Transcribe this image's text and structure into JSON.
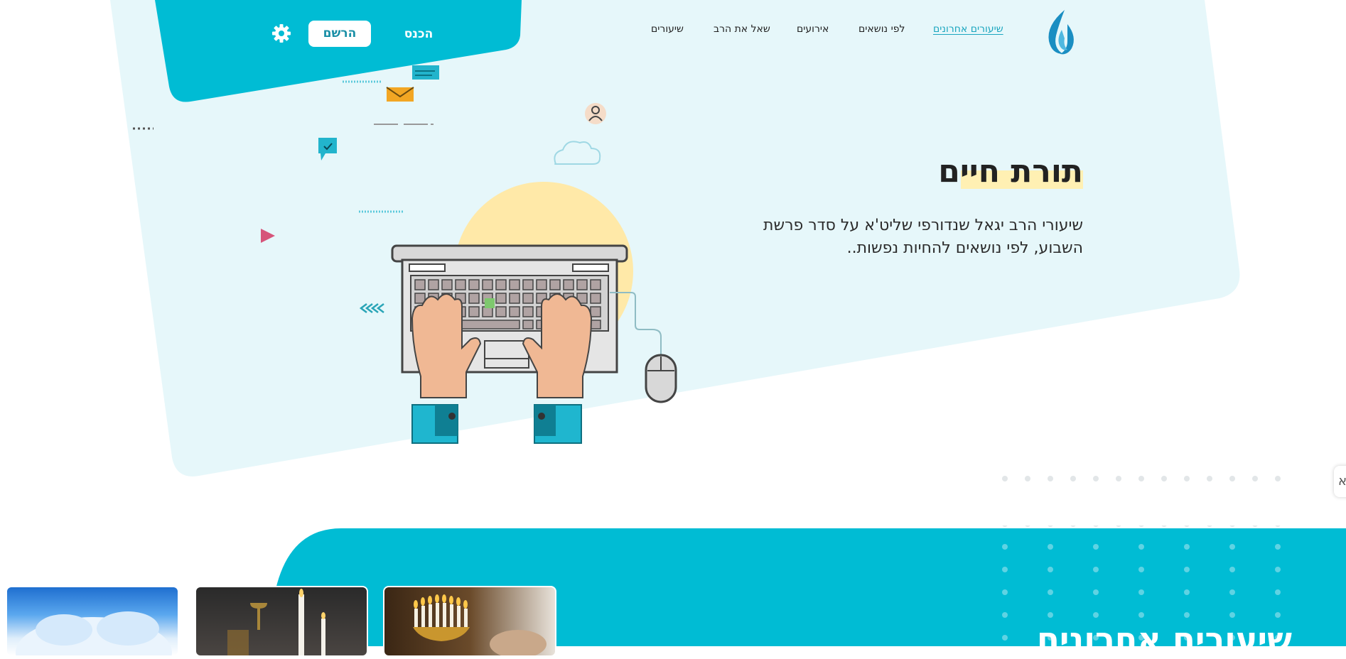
{
  "header": {
    "nav_items": [
      {
        "label": "שיעורים אחרונים",
        "active": true
      },
      {
        "label": "לפי נושאים"
      },
      {
        "label": "אירועים"
      },
      {
        "label": "שאל את הרב"
      },
      {
        "label": "שיעורים"
      }
    ],
    "login_label": "הכנס",
    "register_label": "הרשם",
    "settings_icon": "gear-icon",
    "logo_icon": "flame-logo"
  },
  "hero": {
    "title": "תורת חיים",
    "subtitle": "שיעורי הרב יגאל שנדורפי שליט'א על סדר פרשת השבוע, לפי נושאים להחיות נפשות..",
    "illustration": "laptop-typing-hands"
  },
  "recent": {
    "title": "שיעורים אחרונים",
    "cards": [
      {
        "image": "sky-clouds"
      },
      {
        "image": "kiddush-cup-candles"
      },
      {
        "image": "menorah-hanukkah"
      }
    ]
  },
  "side_tab": {
    "label": "א"
  },
  "colors": {
    "brand": "#00bcd4",
    "hero_bg": "#e6f7fa",
    "highlight": "#fff0b3",
    "text": "#222222"
  }
}
